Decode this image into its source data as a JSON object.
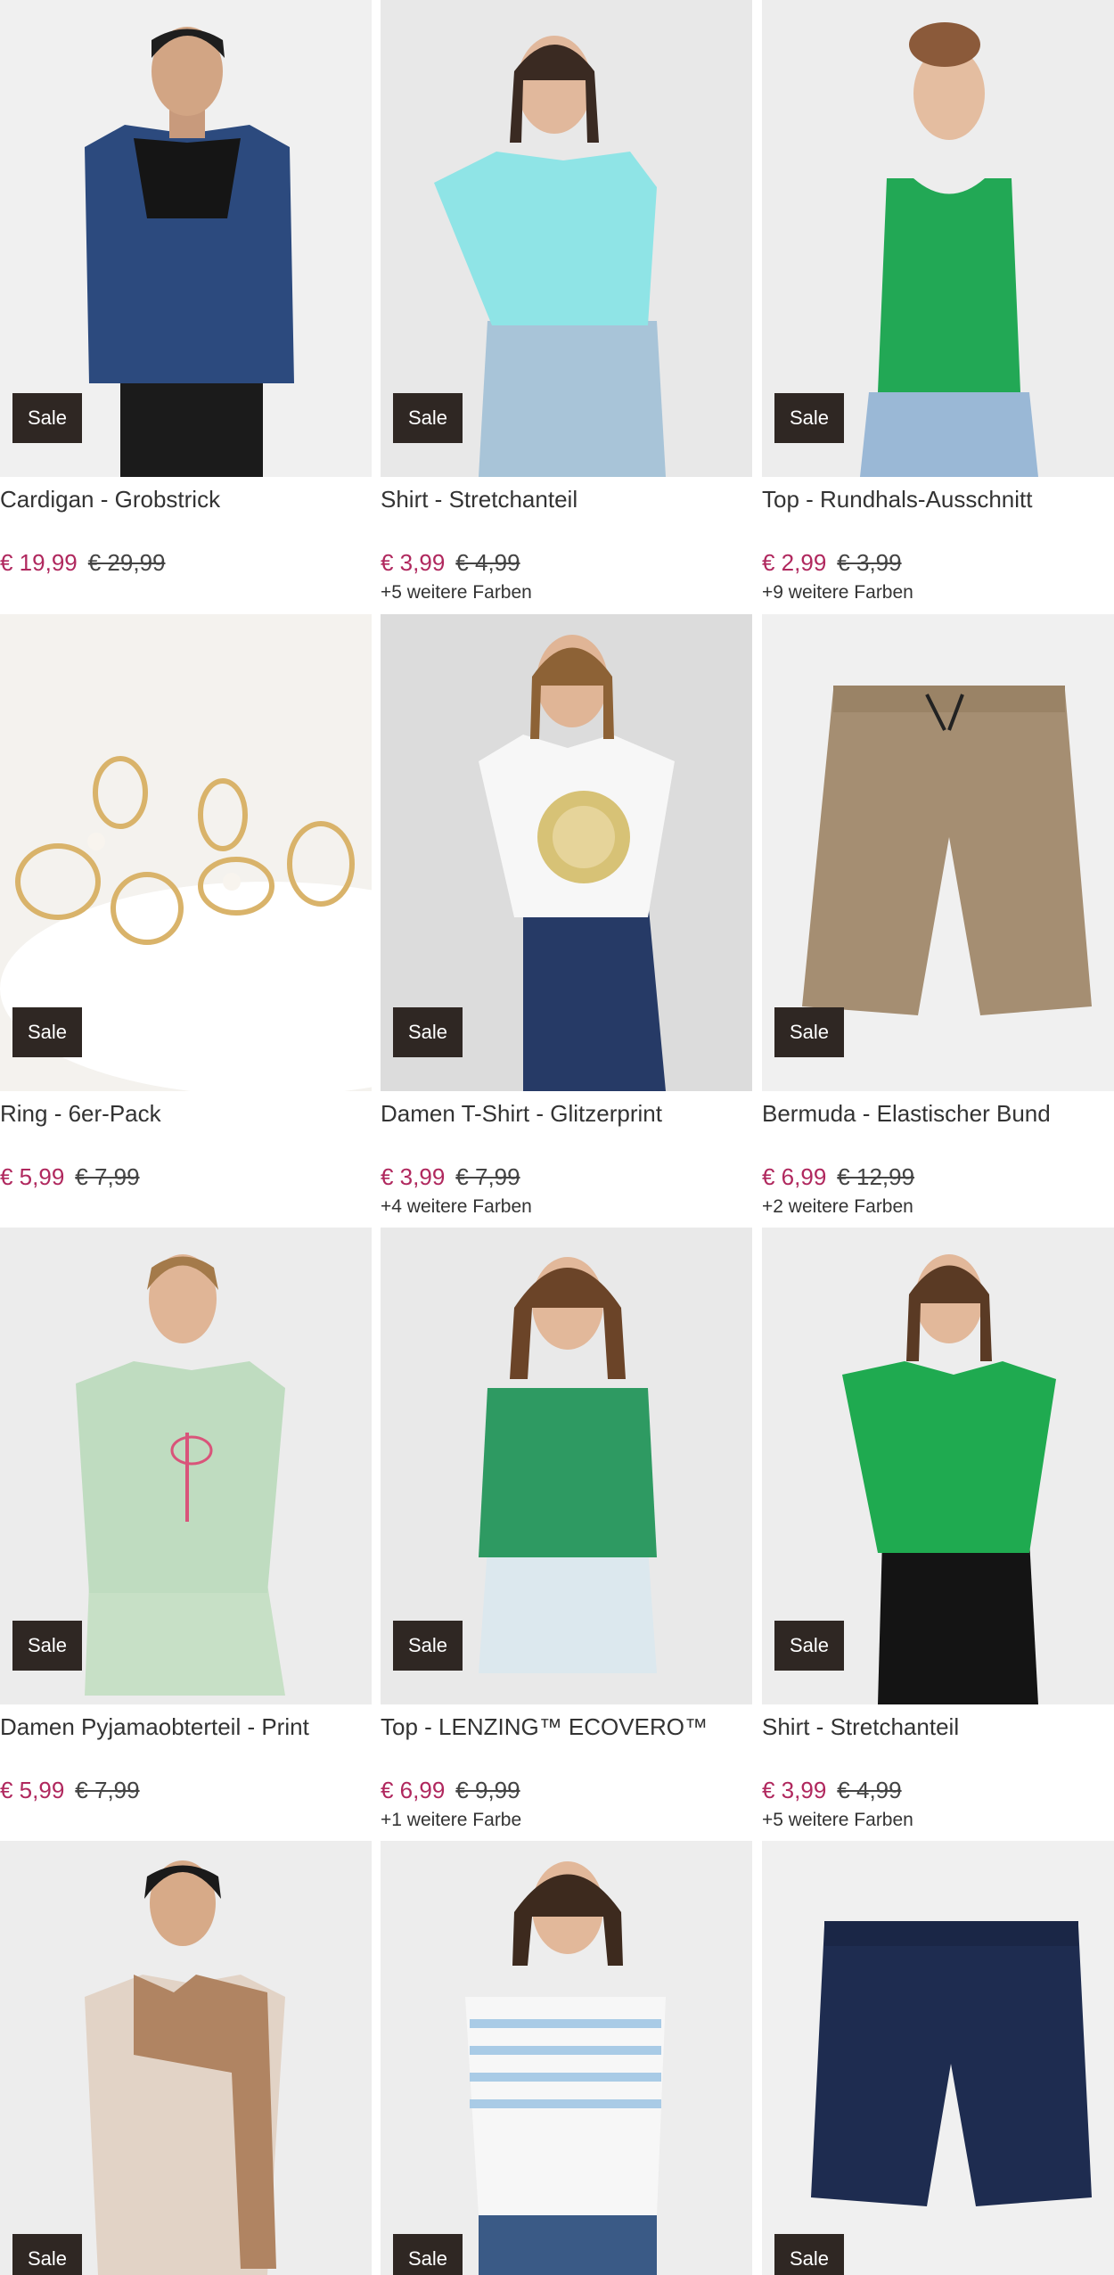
{
  "products": [
    {
      "name": "Cardigan - Grobstrick",
      "badge": "Sale",
      "price": "€ 19,99",
      "old_price": "€ 29,99",
      "colors": ""
    },
    {
      "name": "Shirt - Stretchanteil",
      "badge": "Sale",
      "price": "€ 3,99",
      "old_price": "€ 4,99",
      "colors": "+5 weitere Farben"
    },
    {
      "name": "Top - Rundhals-Ausschnitt",
      "badge": "Sale",
      "price": "€ 2,99",
      "old_price": "€ 3,99",
      "colors": "+9 weitere Farben"
    },
    {
      "name": "Ring - 6er-Pack",
      "badge": "Sale",
      "price": "€ 5,99",
      "old_price": "€ 7,99",
      "colors": ""
    },
    {
      "name": "Damen T-Shirt - Glitzerprint",
      "badge": "Sale",
      "price": "€ 3,99",
      "old_price": "€ 7,99",
      "colors": "+4 weitere Farben"
    },
    {
      "name": "Bermuda - Elastischer Bund",
      "badge": "Sale",
      "price": "€ 6,99",
      "old_price": "€ 12,99",
      "colors": "+2 weitere Farben"
    },
    {
      "name": "Damen Pyjamaobterteil - Print",
      "badge": "Sale",
      "price": "€ 5,99",
      "old_price": "€ 7,99",
      "colors": ""
    },
    {
      "name": "Top - LENZING™ ECOVERO™",
      "badge": "Sale",
      "price": "€ 6,99",
      "old_price": "€ 9,99",
      "colors": "+1 weitere Farbe"
    },
    {
      "name": "Shirt - Stretchanteil",
      "badge": "Sale",
      "price": "€ 3,99",
      "old_price": "€ 4,99",
      "colors": "+5 weitere Farben"
    },
    {
      "badge": "Sale"
    },
    {
      "badge": "Sale"
    },
    {
      "badge": "Sale"
    }
  ],
  "colors": {
    "sale_badge": "#2f2723",
    "price_now": "#b0285e",
    "photo_bg": "#f1f1f1"
  }
}
